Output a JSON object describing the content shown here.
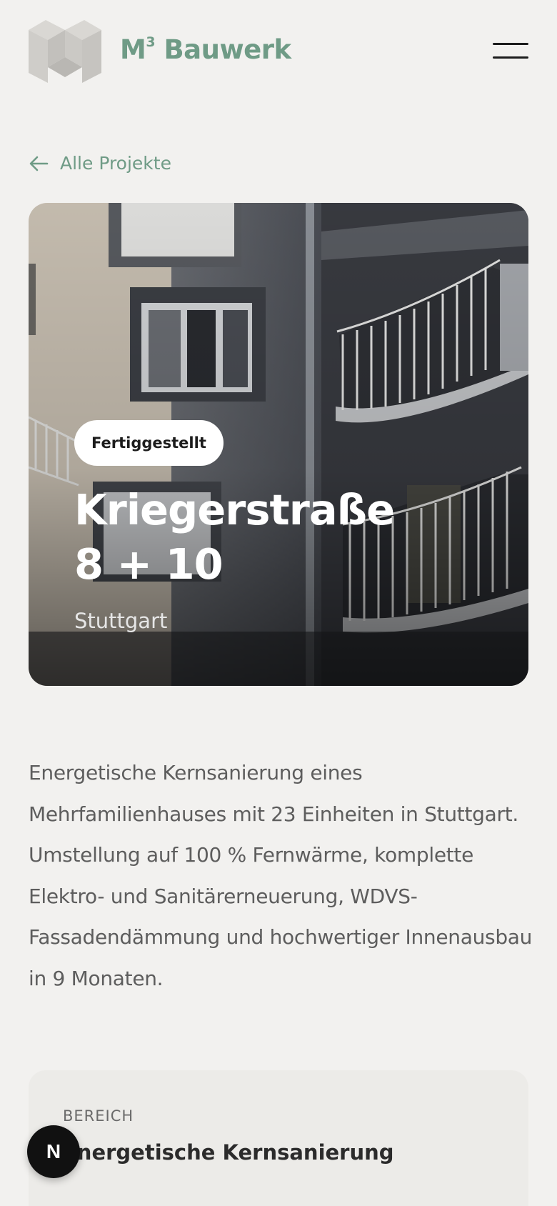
{
  "header": {
    "brand_name": "M³ Bauwerk",
    "brand_prefix": "M",
    "brand_sup": "3",
    "brand_suffix": " Bauwerk",
    "logo_icon": "m3-cube-logo",
    "menu_icon": "hamburger-menu-icon"
  },
  "back_link": {
    "label": "Alle Projekte",
    "icon": "arrow-left-icon"
  },
  "hero": {
    "status_badge": "Fertiggestellt",
    "title_line1": "Kriegerstraße",
    "title_line2": "8 + 10",
    "city": "Stuttgart"
  },
  "description": "Energetische Kernsanierung eines Mehrfamilienhauses mit 23 Einheiten in Stuttgart. Umstellung auf 100 % Fernwärme, komplette Elektro- und Sanitärerneuerung, WDVS-Fassadendämmung und hochwertiger Innenausbau in 9 Monaten.",
  "info_card": {
    "label": "BEREICH",
    "value": "Energetische Kernsanierung"
  },
  "fab": {
    "label": "N"
  },
  "colors": {
    "accent": "#6f9b86",
    "background": "#f2f1ef",
    "text": "#2b2b2b"
  }
}
